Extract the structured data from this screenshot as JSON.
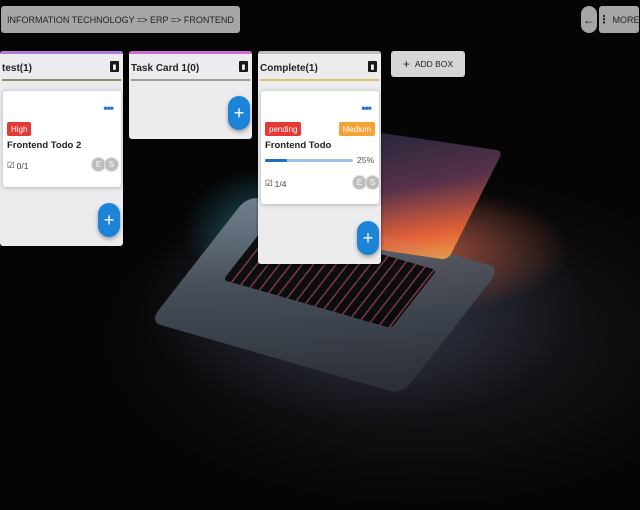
{
  "header": {
    "breadcrumb": "INFORMATION TECHNOLOGY => ERP => FRONTEND",
    "back_icon": "arrow-left-icon",
    "more_label": "MORE",
    "more_icon": "vertical-dots-icon"
  },
  "columns": [
    {
      "title": "test(1)",
      "accent": "#b07cd8",
      "underline": "#8d8f6a",
      "cards": [
        {
          "priority": "High",
          "priority_color": "#e53935",
          "title": "Frontend Todo 2",
          "checklist": "0/1",
          "avatars": [
            "E",
            "S"
          ]
        }
      ]
    },
    {
      "title": "Task Card 1(0)",
      "accent": "#d06ad6",
      "underline": "#9c9c9c",
      "cards": []
    },
    {
      "title": "Complete(1)",
      "accent": "#bdbdbd",
      "underline": "#d4c46a",
      "cards": [
        {
          "status": "pending",
          "status_color": "#e53935",
          "priority": "Medium",
          "priority_color": "#f4a236",
          "title": "Frontend Todo",
          "progress": 0.25,
          "progress_label": "25%",
          "checklist": "1/4",
          "avatars": [
            "E",
            "S"
          ]
        }
      ]
    }
  ],
  "add_box_label": "ADD BOX",
  "colors": {
    "fab": "#1b84d6",
    "header_button": "#a6a6a6"
  }
}
